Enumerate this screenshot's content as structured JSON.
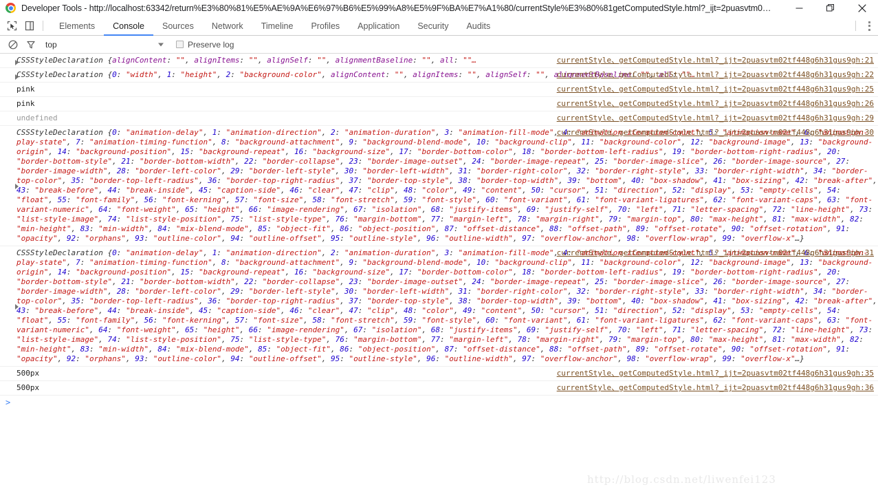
{
  "window": {
    "title": "Developer Tools - http://localhost:63342/return%E3%80%81%E5%AE%9A%E6%97%B6%E5%99%A8%E5%9F%BA%E7%A1%80/currentStyle%E3%80%81getComputedStyle.html?_ijt=2puasvtm0…",
    "minimize_label": "—",
    "maximize_label": "❐",
    "close_label": "✕"
  },
  "toolbar": {
    "inspect_icon": "inspect-element-icon",
    "device_icon": "toggle-device-toolbar-icon",
    "kebab_icon": "more-options-icon",
    "tabs": [
      {
        "label": "Elements",
        "active": false
      },
      {
        "label": "Console",
        "active": true
      },
      {
        "label": "Sources",
        "active": false
      },
      {
        "label": "Network",
        "active": false
      },
      {
        "label": "Timeline",
        "active": false
      },
      {
        "label": "Profiles",
        "active": false
      },
      {
        "label": "Application",
        "active": false
      },
      {
        "label": "Security",
        "active": false
      },
      {
        "label": "Audits",
        "active": false
      }
    ]
  },
  "filterbar": {
    "clear_icon": "clear-console-icon",
    "filter_icon": "filter-funnel-icon",
    "context_value": "top",
    "preserve_log_label": "Preserve log",
    "preserve_log_checked": false
  },
  "console": {
    "prompt_glyph": ">",
    "link_base": "currentStyle、getComputedStyle.html?_ijt=2puasvtm02tf448g6h31gus9gh",
    "messages": [
      {
        "kind": "object",
        "expandable": true,
        "class_name": "CSSStyleDeclaration",
        "text": "CSSStyleDeclaration {alignContent: \"\", alignItems: \"\", alignSelf: \"\", alignmentBaseline: \"\", all: \"\"…}",
        "link": "currentStyle、getComputedStyle.html?_ijt=2puasvtm02tf448g6h31gus9gh:21"
      },
      {
        "kind": "object",
        "expandable": true,
        "class_name": "CSSStyleDeclaration",
        "text": "CSSStyleDeclaration {0: \"width\", 1: \"height\", 2: \"background-color\", alignContent: \"\", alignItems: \"\", alignSelf: \"\", alignmentBaseline: \"\", all: \"\"…}",
        "link": "currentStyle、getComputedStyle.html?_ijt=2puasvtm02tf448g6h31gus9gh:22"
      },
      {
        "kind": "simple",
        "expandable": false,
        "text": "pink",
        "link": "currentStyle、getComputedStyle.html?_ijt=2puasvtm02tf448g6h31gus9gh:25"
      },
      {
        "kind": "simple",
        "expandable": false,
        "text": "pink",
        "link": "currentStyle、getComputedStyle.html?_ijt=2puasvtm02tf448g6h31gus9gh:26"
      },
      {
        "kind": "undefined",
        "expandable": false,
        "text": "undefined",
        "link": "currentStyle、getComputedStyle.html?_ijt=2puasvtm02tf448g6h31gus9gh:29"
      },
      {
        "kind": "object-big",
        "expandable": true,
        "class_name": "CSSStyleDeclaration",
        "link": "currentStyle、getComputedStyle.html?_ijt=2puasvtm02tf448g6h31gus9gh:30",
        "properties": [
          "animation-delay",
          "animation-direction",
          "animation-duration",
          "animation-fill-mode",
          "animation-iteration-count",
          "animation-name",
          "animation-play-state",
          "animation-timing-function",
          "background-attachment",
          "background-blend-mode",
          "background-clip",
          "background-color",
          "background-image",
          "background-origin",
          "background-position",
          "background-repeat",
          "background-size",
          "border-bottom-color",
          "border-bottom-left-radius",
          "border-bottom-right-radius",
          "border-bottom-style",
          "border-bottom-width",
          "border-collapse",
          "border-image-outset",
          "border-image-repeat",
          "border-image-slice",
          "border-image-source",
          "border-image-width",
          "border-left-color",
          "border-left-style",
          "border-left-width",
          "border-right-color",
          "border-right-style",
          "border-right-width",
          "border-top-color",
          "border-top-left-radius",
          "border-top-right-radius",
          "border-top-style",
          "border-top-width",
          "bottom",
          "box-shadow",
          "box-sizing",
          "break-after",
          "break-before",
          "break-inside",
          "caption-side",
          "clear",
          "clip",
          "color",
          "content",
          "cursor",
          "direction",
          "display",
          "empty-cells",
          "float",
          "font-family",
          "font-kerning",
          "font-size",
          "font-stretch",
          "font-style",
          "font-variant",
          "font-variant-ligatures",
          "font-variant-caps",
          "font-variant-numeric",
          "font-weight",
          "height",
          "image-rendering",
          "isolation",
          "justify-items",
          "justify-self",
          "left",
          "letter-spacing",
          "line-height",
          "list-style-image",
          "list-style-position",
          "list-style-type",
          "margin-bottom",
          "margin-left",
          "margin-right",
          "margin-top",
          "max-height",
          "max-width",
          "min-height",
          "min-width",
          "mix-blend-mode",
          "object-fit",
          "object-position",
          "offset-distance",
          "offset-path",
          "offset-rotate",
          "offset-rotation",
          "opacity",
          "orphans",
          "outline-color",
          "outline-offset",
          "outline-style",
          "outline-width",
          "overflow-anchor",
          "overflow-wrap",
          "overflow-x"
        ],
        "ellipsis": "…}"
      },
      {
        "kind": "object-big",
        "expandable": true,
        "class_name": "CSSStyleDeclaration",
        "link": "currentStyle、getComputedStyle.html?_ijt=2puasvtm02tf448g6h31gus9gh:31",
        "properties": [
          "animation-delay",
          "animation-direction",
          "animation-duration",
          "animation-fill-mode",
          "animation-iteration-count",
          "animation-name",
          "animation-play-state",
          "animation-timing-function",
          "background-attachment",
          "background-blend-mode",
          "background-clip",
          "background-color",
          "background-image",
          "background-origin",
          "background-position",
          "background-repeat",
          "background-size",
          "border-bottom-color",
          "border-bottom-left-radius",
          "border-bottom-right-radius",
          "border-bottom-style",
          "border-bottom-width",
          "border-collapse",
          "border-image-outset",
          "border-image-repeat",
          "border-image-slice",
          "border-image-source",
          "border-image-width",
          "border-left-color",
          "border-left-style",
          "border-left-width",
          "border-right-color",
          "border-right-style",
          "border-right-width",
          "border-top-color",
          "border-top-left-radius",
          "border-top-right-radius",
          "border-top-style",
          "border-top-width",
          "bottom",
          "box-shadow",
          "box-sizing",
          "break-after",
          "break-before",
          "break-inside",
          "caption-side",
          "clear",
          "clip",
          "color",
          "content",
          "cursor",
          "direction",
          "display",
          "empty-cells",
          "float",
          "font-family",
          "font-kerning",
          "font-size",
          "font-stretch",
          "font-style",
          "font-variant",
          "font-variant-ligatures",
          "font-variant-caps",
          "font-variant-numeric",
          "font-weight",
          "height",
          "image-rendering",
          "isolation",
          "justify-items",
          "justify-self",
          "left",
          "letter-spacing",
          "line-height",
          "list-style-image",
          "list-style-position",
          "list-style-type",
          "margin-bottom",
          "margin-left",
          "margin-right",
          "margin-top",
          "max-height",
          "max-width",
          "min-height",
          "min-width",
          "mix-blend-mode",
          "object-fit",
          "object-position",
          "offset-distance",
          "offset-path",
          "offset-rotate",
          "offset-rotation",
          "opacity",
          "orphans",
          "outline-color",
          "outline-offset",
          "outline-style",
          "outline-width",
          "overflow-anchor",
          "overflow-wrap",
          "overflow-x"
        ],
        "ellipsis": "…}"
      },
      {
        "kind": "simple",
        "expandable": false,
        "text": "500px",
        "link": "currentStyle、getComputedStyle.html?_ijt=2puasvtm02tf448g6h31gus9gh:35"
      },
      {
        "kind": "simple",
        "expandable": false,
        "text": "500px",
        "link": "currentStyle、getComputedStyle.html?_ijt=2puasvtm02tf448g6h31gus9gh:36"
      }
    ]
  },
  "watermark": {
    "text": "http://blog.csdn.net/liwenfei123"
  },
  "colors": {
    "accent": "#4285f4",
    "link": "#7a4f22",
    "key": "#881391",
    "string": "#c41a16",
    "number": "#1c00cf"
  }
}
